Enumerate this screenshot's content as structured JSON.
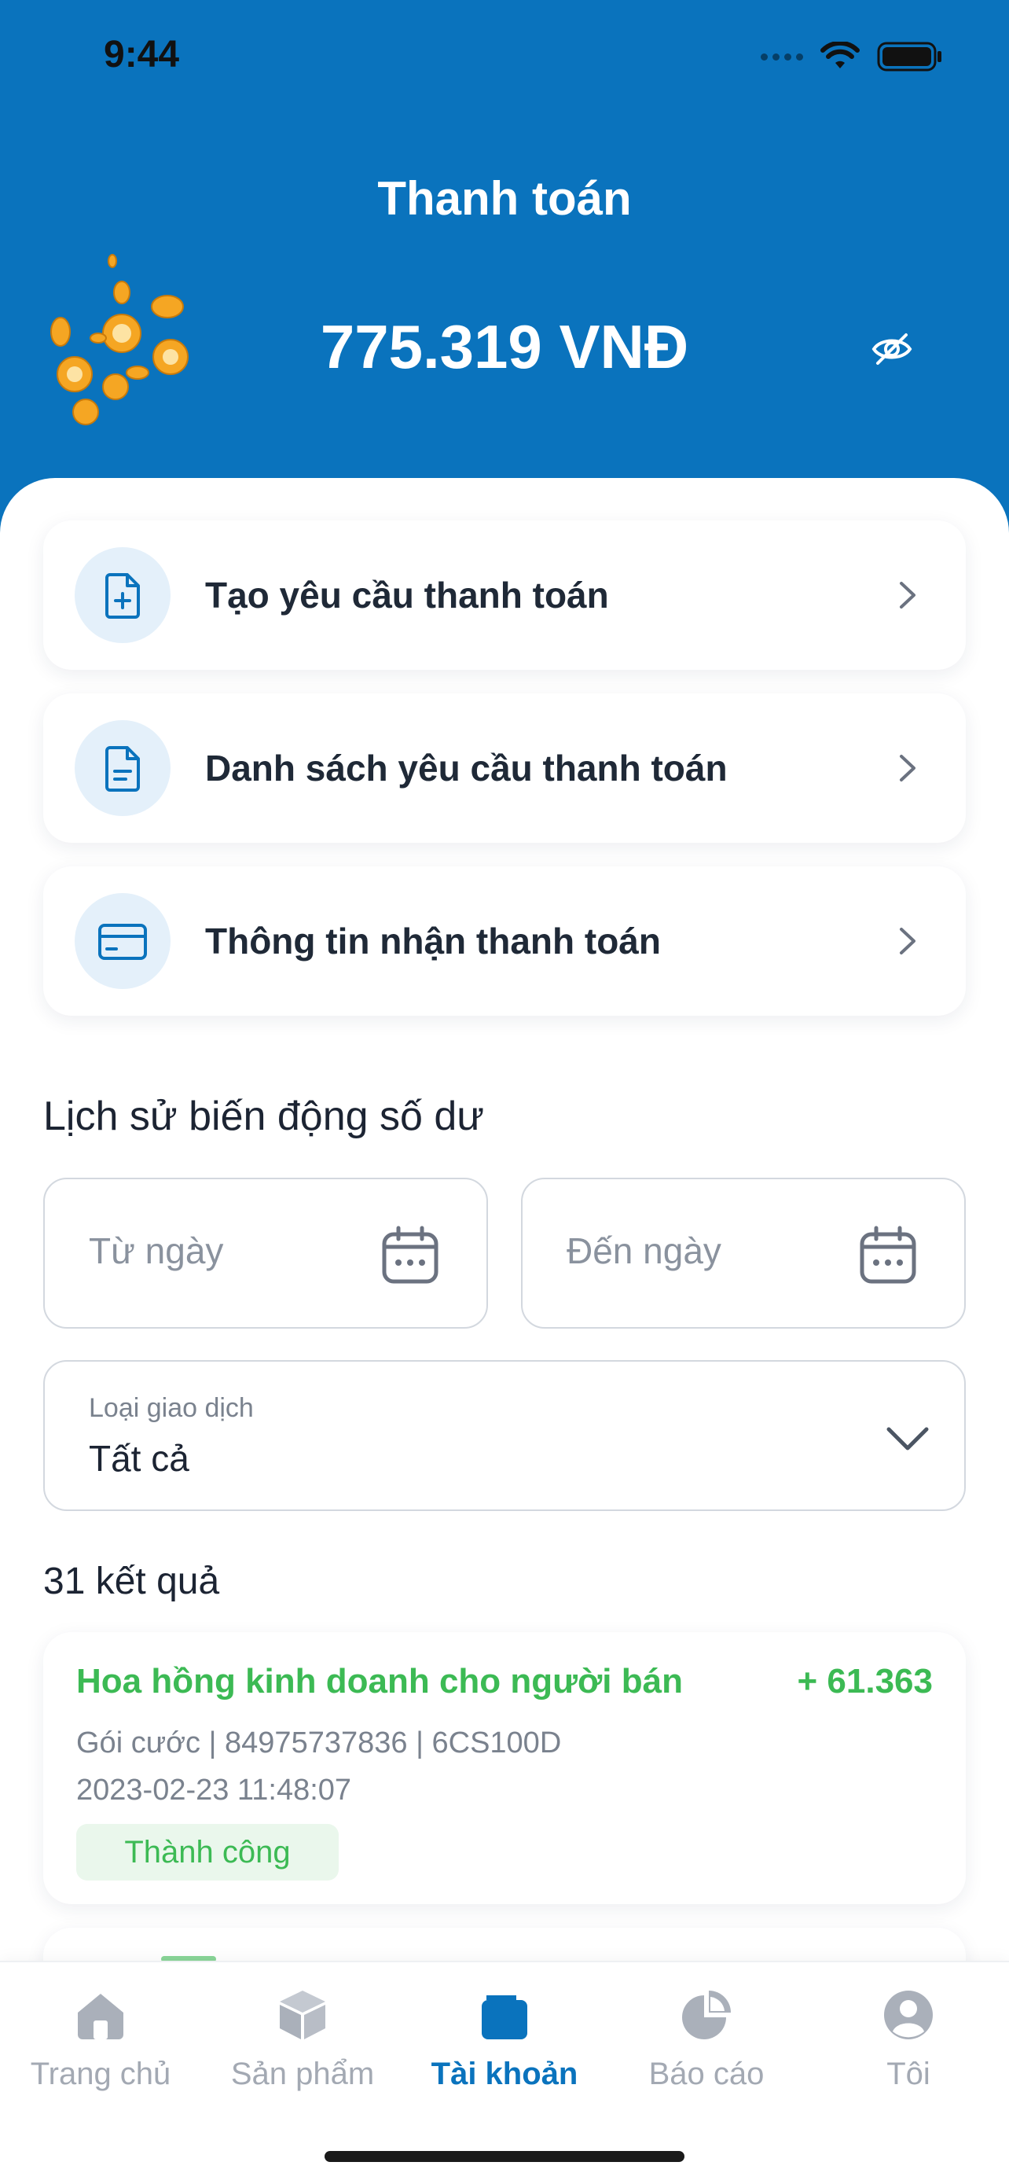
{
  "status_bar": {
    "time": "9:44"
  },
  "header": {
    "title": "Thanh toán",
    "balance": "775.319 VNĐ",
    "toggle_icon": "eye-off-icon"
  },
  "colors": {
    "primary": "#0a73bd",
    "success": "#3cba54",
    "icon_bg": "#e4f0fa"
  },
  "menu": [
    {
      "label": "Tạo yêu cầu thanh toán",
      "icon": "file-plus-icon"
    },
    {
      "label": "Danh sách yêu cầu thanh toán",
      "icon": "document-icon"
    },
    {
      "label": "Thông tin nhận thanh toán",
      "icon": "credit-card-icon"
    }
  ],
  "history": {
    "title": "Lịch sử biến động số dư",
    "from_placeholder": "Từ ngày",
    "to_placeholder": "Đến ngày",
    "type_label": "Loại giao dịch",
    "type_value": "Tất cả",
    "result_count": "31 kết quả",
    "transactions": [
      {
        "title": "Hoa hồng kinh doanh cho người bán",
        "amount": "+ 61.363",
        "description": "Gói cước | 84975737836 | 6CS100D",
        "time": "2023-02-23 11:48:07",
        "status": "Thành công"
      }
    ]
  },
  "tabs": [
    {
      "label": "Trang chủ",
      "icon": "home-icon",
      "active": false
    },
    {
      "label": "Sản phẩm",
      "icon": "box-icon",
      "active": false
    },
    {
      "label": "Tài khoản",
      "icon": "wallet-icon",
      "active": true
    },
    {
      "label": "Báo cáo",
      "icon": "pie-chart-icon",
      "active": false
    },
    {
      "label": "Tôi",
      "icon": "user-icon",
      "active": false
    }
  ]
}
